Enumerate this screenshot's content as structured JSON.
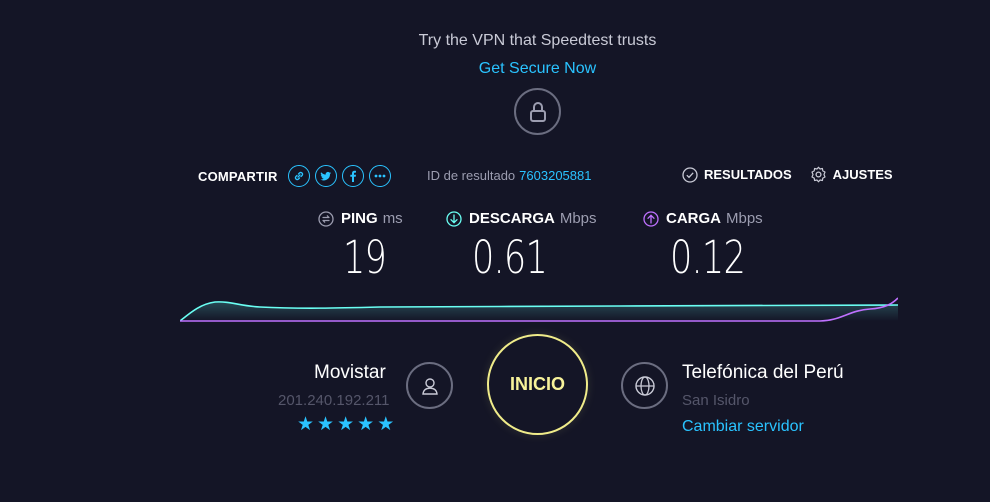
{
  "promo": {
    "text": "Try the VPN that Speedtest trusts",
    "link": "Get Secure Now"
  },
  "lock_icon": "lock-icon",
  "share": {
    "label": "COMPARTIR",
    "icons": [
      "link-icon",
      "twitter-icon",
      "facebook-icon",
      "more-icon"
    ]
  },
  "result": {
    "label": "ID de resultado",
    "id": "7603205881"
  },
  "nav": {
    "results": "RESULTADOS",
    "settings": "AJUSTES"
  },
  "metrics": {
    "ping": {
      "label": "PING",
      "unit": "ms",
      "value": "19",
      "color": "#9c9db0"
    },
    "download": {
      "label": "DESCARGA",
      "unit": "Mbps",
      "value": "0.61",
      "color": "#6afff3"
    },
    "upload": {
      "label": "CARGA",
      "unit": "Mbps",
      "value": "0.12",
      "color": "#bf71ff"
    }
  },
  "isp": {
    "name": "Movistar",
    "ip": "201.240.192.211",
    "stars": 5
  },
  "go": {
    "label": "INICIO"
  },
  "server": {
    "name": "Telefónica del Perú",
    "location": "San Isidro",
    "change": "Cambiar servidor"
  }
}
